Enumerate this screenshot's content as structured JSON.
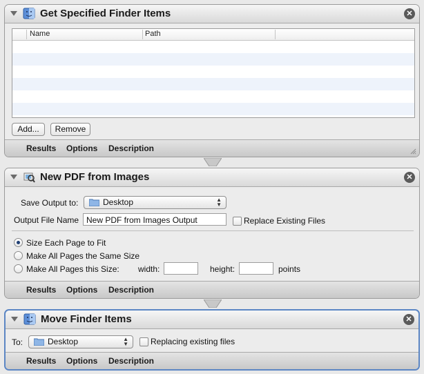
{
  "colors": {
    "background": "#e9e9e9",
    "selected_border": "#5b86c4",
    "alt_row": "#eef3fb"
  },
  "action1": {
    "title": "Get Specified Finder Items",
    "icon": "finder-icon",
    "columns": [
      "Name",
      "Path"
    ],
    "add_label": "Add...",
    "remove_label": "Remove",
    "footer": {
      "results": "Results",
      "options": "Options",
      "description": "Description"
    }
  },
  "action2": {
    "title": "New PDF from Images",
    "icon": "preview-icon",
    "save_output_label": "Save Output to:",
    "save_output_value": "Desktop",
    "output_file_label": "Output File Name",
    "output_file_value": "New PDF from Images Output",
    "replace_label": "Replace Existing Files",
    "replace_checked": false,
    "size_options": [
      "Size Each Page to Fit",
      "Make All Pages the Same Size",
      "Make All Pages this Size:"
    ],
    "selected_size_option": 0,
    "width_label": "width:",
    "height_label": "height:",
    "points_label": "points",
    "footer": {
      "results": "Results",
      "options": "Options",
      "description": "Description"
    }
  },
  "action3": {
    "title": "Move Finder Items",
    "icon": "finder-icon",
    "to_label": "To:",
    "to_value": "Desktop",
    "replacing_label": "Replacing existing files",
    "replacing_checked": false,
    "footer": {
      "results": "Results",
      "options": "Options",
      "description": "Description"
    }
  }
}
